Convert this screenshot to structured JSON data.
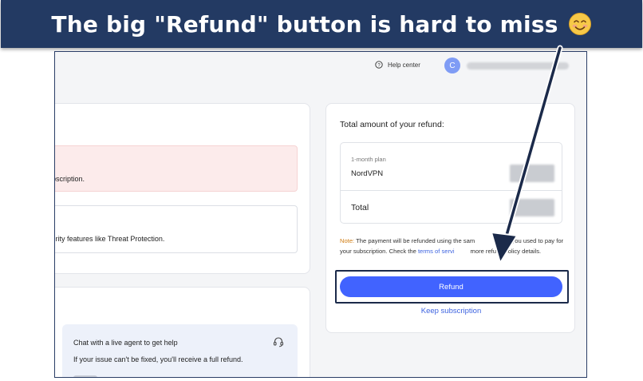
{
  "banner": {
    "title": "The big \"Refund\" button is hard to miss",
    "emoji": "smiling-face-emoji"
  },
  "topbar": {
    "help_label": "Help center",
    "avatar_initial": "C"
  },
  "left_top_card": {
    "alert_line1_fragment": "s",
    "alert_line2_fragment": "ubscription.",
    "feature_line_fragment": "curity features like Threat Protection."
  },
  "left_bottom_card": {
    "chat_title": "Chat with a live agent to get help",
    "chat_subtitle": "If your issue can't be fixed, you'll receive a full refund."
  },
  "refund_card": {
    "heading": "Total amount of your refund:",
    "plan_label": "1-month plan",
    "plan_name": "NordVPN",
    "total_label": "Total",
    "note_label": "Note:",
    "note_text_1": "The payment will be refunded using the sam",
    "note_text_2": "d you used to pay for your subscription. Check the",
    "tos_link": "terms of servi",
    "note_text_3": "more refund policy details.",
    "refund_button": "Refund",
    "keep_link": "Keep subscription"
  },
  "colors": {
    "banner_bg": "#233a63",
    "accent": "#4163ff",
    "link": "#3d63e0",
    "note_label": "#d07c12",
    "alert_bg": "#fcebeb"
  }
}
